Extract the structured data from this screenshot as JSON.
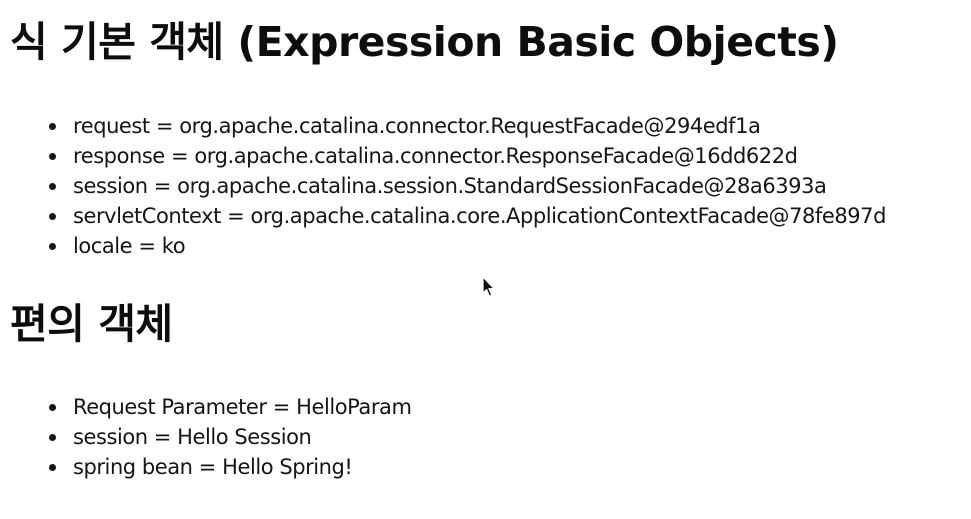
{
  "sections": [
    {
      "title": "식 기본 객체 (Expression Basic Objects)",
      "items": [
        "request = org.apache.catalina.connector.RequestFacade@294edf1a",
        "response = org.apache.catalina.connector.ResponseFacade@16dd622d",
        "session = org.apache.catalina.session.StandardSessionFacade@28a6393a",
        "servletContext = org.apache.catalina.core.ApplicationContextFacade@78fe897d",
        "locale = ko"
      ]
    },
    {
      "title": "편의 객체",
      "items": [
        "Request Parameter = HelloParam",
        "session = Hello Session",
        "spring bean = Hello Spring!"
      ]
    }
  ],
  "icons": {
    "cursor": "mouse-pointer-icon",
    "bullet": "bullet-icon"
  },
  "colors": {
    "background": "#ffffff",
    "text": "#111111"
  }
}
